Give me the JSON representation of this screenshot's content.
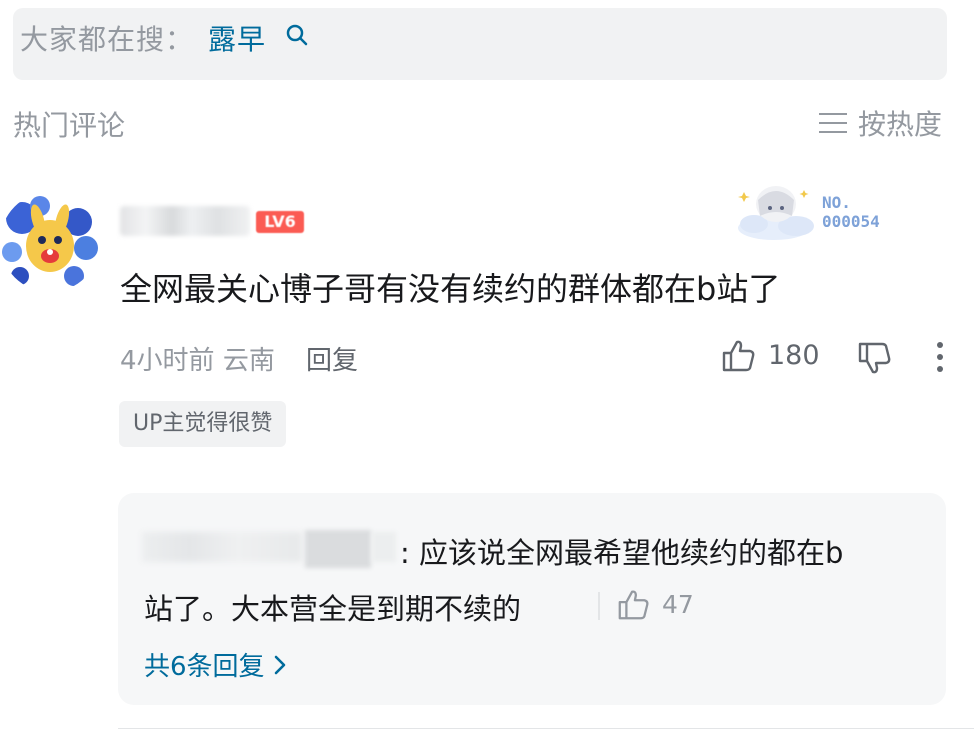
{
  "search": {
    "prefix": "大家都在搜：",
    "keyword": "露早",
    "icon": "search-icon"
  },
  "section": {
    "title": "热门评论",
    "sort_label": "按热度",
    "sort_icon": "list-sort-icon"
  },
  "comment": {
    "level_badge": "LV6",
    "fan_card": {
      "label": "NO.",
      "number": "000054"
    },
    "text": "全网最关心博子哥有没有续约的群体都在b站了",
    "time": "4小时前",
    "location": "云南",
    "reply_label": "回复",
    "like_count": "180",
    "up_badge": "UP主觉得很赞"
  },
  "reply": {
    "text_line1": ": 应该说全网最希望他续约的都在b",
    "text_line2": "站了。大本营全是到期不续的",
    "like_count": "47",
    "view_all": "共6条回复"
  },
  "colors": {
    "accent": "#006b9c",
    "muted": "#9499a0",
    "badge_red": "#fb5b53"
  }
}
